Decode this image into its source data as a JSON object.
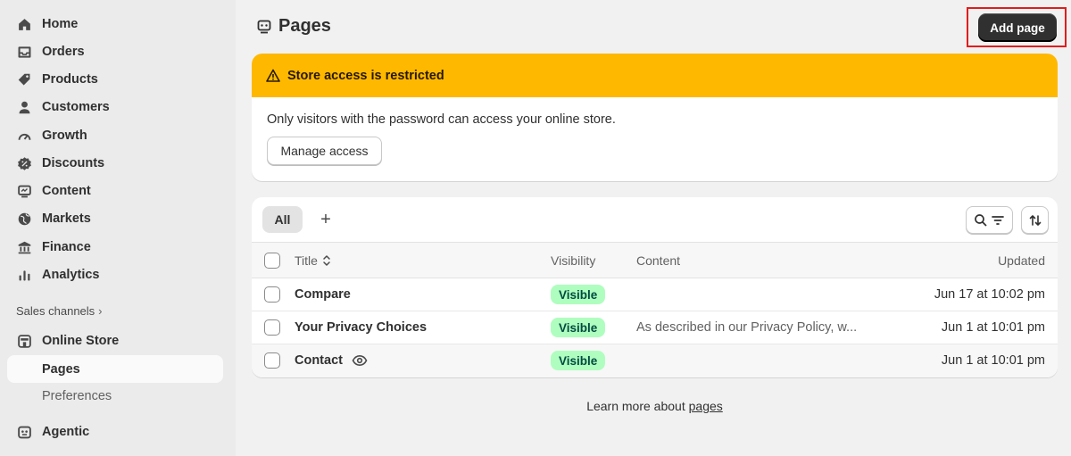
{
  "sidebar": {
    "items": [
      {
        "label": "Home",
        "icon": "home-icon"
      },
      {
        "label": "Orders",
        "icon": "inbox-icon"
      },
      {
        "label": "Products",
        "icon": "tag-icon"
      },
      {
        "label": "Customers",
        "icon": "person-icon"
      },
      {
        "label": "Growth",
        "icon": "gauge-icon"
      },
      {
        "label": "Discounts",
        "icon": "discount-icon"
      },
      {
        "label": "Content",
        "icon": "content-icon"
      },
      {
        "label": "Markets",
        "icon": "globe-icon"
      },
      {
        "label": "Finance",
        "icon": "bank-icon"
      },
      {
        "label": "Analytics",
        "icon": "bar-chart-icon"
      }
    ],
    "sales_channels_label": "Sales channels",
    "online_store_label": "Online Store",
    "pages_label": "Pages",
    "preferences_label": "Preferences",
    "agentic_label": "Agentic"
  },
  "header": {
    "title": "Pages",
    "add_button": "Add page"
  },
  "banner": {
    "title": "Store access is restricted",
    "body": "Only visitors with the password can access your online store.",
    "button": "Manage access",
    "color": "#ffb800"
  },
  "table": {
    "tab_all": "All",
    "tab_add": "+",
    "columns": {
      "title": "Title",
      "visibility": "Visibility",
      "content": "Content",
      "updated": "Updated"
    },
    "rows": [
      {
        "title": "Compare",
        "visibility": "Visible",
        "content": "",
        "updated": "Jun 17 at 10:02 pm"
      },
      {
        "title": "Your Privacy Choices",
        "visibility": "Visible",
        "content": "As described in our Privacy Policy, w...",
        "updated": "Jun 1 at 10:01 pm"
      },
      {
        "title": "Contact",
        "visibility": "Visible",
        "content": "",
        "updated": "Jun 1 at 10:01 pm"
      }
    ]
  },
  "footer": {
    "learn_text": "Learn more about",
    "learn_link": "pages"
  }
}
